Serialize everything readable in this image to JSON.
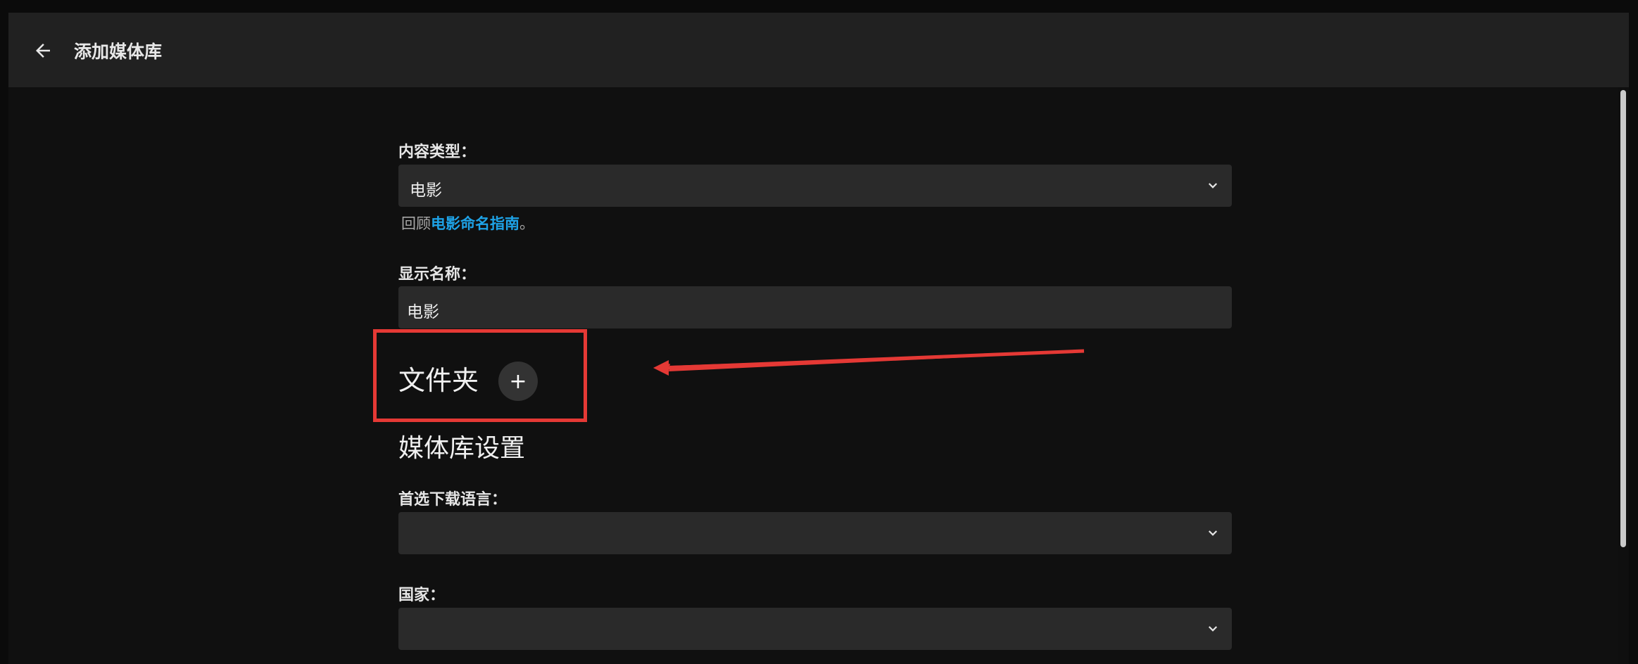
{
  "header": {
    "title": "添加媒体库",
    "back_icon": "arrow-left-icon"
  },
  "form": {
    "content_type": {
      "label": "内容类型：",
      "value": "电影"
    },
    "helper": {
      "prefix": "回顾",
      "link": "电影命名指南",
      "suffix": "。"
    },
    "display_name": {
      "label": "显示名称：",
      "value": "电影"
    },
    "folders": {
      "title": "文件夹",
      "add_label": "+"
    },
    "library_settings": {
      "title": "媒体库设置"
    },
    "preferred_language": {
      "label": "首选下载语言：",
      "value": ""
    },
    "country": {
      "label": "国家：",
      "value": ""
    }
  },
  "annotation": {
    "box_color": "#e53935",
    "arrow_color": "#e53935"
  }
}
